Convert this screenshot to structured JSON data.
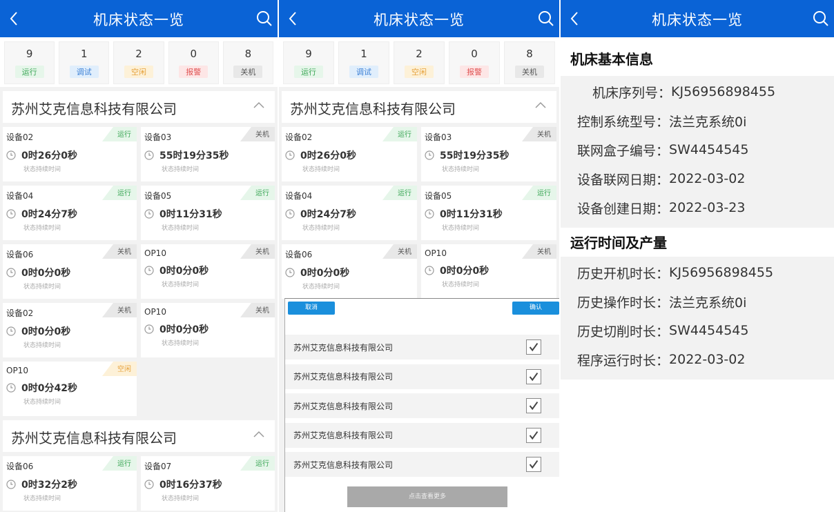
{
  "app_title": "机床状态一览",
  "stats": [
    {
      "count": "9",
      "label": "运行",
      "cls": "b-run"
    },
    {
      "count": "1",
      "label": "调试",
      "cls": "b-debug"
    },
    {
      "count": "2",
      "label": "空闲",
      "cls": "b-idle"
    },
    {
      "count": "0",
      "label": "报警",
      "cls": "b-alarm"
    },
    {
      "count": "8",
      "label": "关机",
      "cls": "b-off"
    }
  ],
  "company_name": "苏州艾克信息科技有限公司",
  "status_caption": "状态持续时间",
  "panel1_group1": [
    {
      "name": "设备02",
      "status": "运行",
      "cls": "b-run",
      "time": "0时26分0秒"
    },
    {
      "name": "设备03",
      "status": "关机",
      "cls": "b-off",
      "time": "55时19分35秒"
    },
    {
      "name": "设备04",
      "status": "运行",
      "cls": "b-run",
      "time": "0时24分7秒"
    },
    {
      "name": "设备05",
      "status": "运行",
      "cls": "b-run",
      "time": "0时11分31秒"
    },
    {
      "name": "设备06",
      "status": "关机",
      "cls": "b-off",
      "time": "0时0分0秒"
    },
    {
      "name": "OP10",
      "status": "关机",
      "cls": "b-off",
      "time": "0时0分0秒"
    },
    {
      "name": "设备02",
      "status": "关机",
      "cls": "b-off",
      "time": "0时0分0秒"
    },
    {
      "name": "OP10",
      "status": "关机",
      "cls": "b-off",
      "time": "0时0分0秒"
    },
    {
      "name": "OP10",
      "status": "空闲",
      "cls": "b-idle",
      "time": "0时0分42秒"
    }
  ],
  "panel1_group2": [
    {
      "name": "设备06",
      "status": "运行",
      "cls": "b-run",
      "time": "0时32分2秒"
    },
    {
      "name": "设备07",
      "status": "运行",
      "cls": "b-run",
      "time": "0时16分37秒"
    }
  ],
  "panel2_group1": [
    {
      "name": "设备02",
      "status": "运行",
      "cls": "b-run",
      "time": "0时26分0秒"
    },
    {
      "name": "设备03",
      "status": "关机",
      "cls": "b-off",
      "time": "55时19分35秒"
    },
    {
      "name": "设备04",
      "status": "运行",
      "cls": "b-run",
      "time": "0时24分7秒"
    },
    {
      "name": "设备05",
      "status": "运行",
      "cls": "b-run",
      "time": "0时11分31秒"
    },
    {
      "name": "设备06",
      "status": "关机",
      "cls": "b-off",
      "time": "0时0分0秒"
    },
    {
      "name": "OP10",
      "status": "关机",
      "cls": "b-off",
      "time": "0时0分0秒"
    }
  ],
  "sheet": {
    "cancel": "取消",
    "confirm": "确认",
    "options": [
      "苏州艾克信息科技有限公司",
      "苏州艾克信息科技有限公司",
      "苏州艾克信息科技有限公司",
      "苏州艾克信息科技有限公司",
      "苏州艾克信息科技有限公司"
    ],
    "more": "点击查看更多"
  },
  "detail": {
    "basic_title": "机床基本信息",
    "basic": [
      {
        "label": "机床序列号：",
        "value": "KJ56956898455"
      },
      {
        "label": "控制系统型号：",
        "value": "法兰克系统0i"
      },
      {
        "label": "联网盒子编号：",
        "value": "SW4454545"
      },
      {
        "label": "设备联网日期：",
        "value": "2022-03-02"
      },
      {
        "label": "设备创建日期：",
        "value": "2022-03-23"
      }
    ],
    "runtime_title": "运行时间及产量",
    "runtime": [
      {
        "label": "历史开机时长：",
        "value": "KJ56956898455"
      },
      {
        "label": "历史操作时长：",
        "value": "法兰克系统0i"
      },
      {
        "label": "历史切削时长：",
        "value": "SW4454545"
      },
      {
        "label": "程序运行时长：",
        "value": "2022-03-02"
      }
    ]
  },
  "colors": {
    "header": "#0a63d6",
    "run": "#3aa655",
    "debug": "#3a7fd5",
    "idle": "#e6a23c",
    "alarm": "#e05252",
    "button": "#1a8fdc"
  }
}
